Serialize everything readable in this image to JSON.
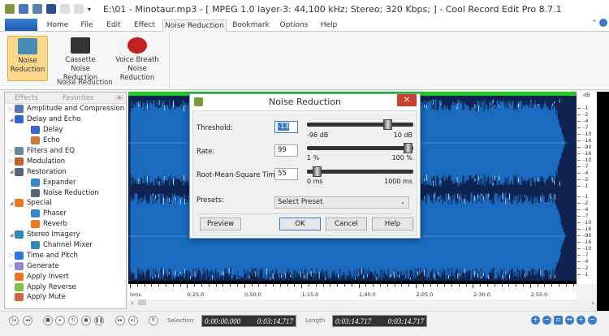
{
  "window": {
    "title": "E:\\01 - Minotaur.mp3 - [ MPEG 1.0 layer-3: 44,100 kHz; Stereo; 320 Kbps;  ] - Cool Record Edit Pro 8.7.1"
  },
  "tabs": [
    {
      "label": "Home"
    },
    {
      "label": "File"
    },
    {
      "label": "Edit"
    },
    {
      "label": "Effect"
    },
    {
      "label": "Noise Reduction"
    },
    {
      "label": "Bookmark"
    },
    {
      "label": "Options"
    },
    {
      "label": "Help"
    }
  ],
  "ribbon": {
    "buttons": [
      {
        "label": "Noise Reduction"
      },
      {
        "label": "Cassette Noise Reduction"
      },
      {
        "label": "Voice Breath Noise Reduction"
      }
    ],
    "group_label": "Noise Reduction"
  },
  "panel": {
    "tabs": [
      "Effects",
      "Favorites"
    ],
    "items": [
      {
        "label": "Amplitude and Compression",
        "level": 0,
        "exp": "closed",
        "color": "#5577aa"
      },
      {
        "label": "Delay and Echo",
        "level": 0,
        "exp": "open",
        "color": "#3366cc"
      },
      {
        "label": "Delay",
        "level": 1,
        "color": "#3366cc"
      },
      {
        "label": "Echo",
        "level": 1,
        "color": "#cc7733"
      },
      {
        "label": "Filters and EQ",
        "level": 0,
        "exp": "closed",
        "color": "#668899"
      },
      {
        "label": "Modulation",
        "level": 0,
        "exp": "closed",
        "color": "#bb6633"
      },
      {
        "label": "Restoration",
        "level": 0,
        "exp": "open",
        "color": "#556677"
      },
      {
        "label": "Expander",
        "level": 1,
        "color": "#3388cc"
      },
      {
        "label": "Noise Reduction",
        "level": 1,
        "color": "#556677"
      },
      {
        "label": "Special",
        "level": 0,
        "exp": "open",
        "color": "#ee7722"
      },
      {
        "label": "Phaser",
        "level": 1,
        "color": "#3388cc"
      },
      {
        "label": "Reverb",
        "level": 1,
        "color": "#ee7722"
      },
      {
        "label": "Stereo Imagery",
        "level": 0,
        "exp": "open",
        "color": "#3388bb"
      },
      {
        "label": "Channel Mixer",
        "level": 1,
        "color": "#3388bb"
      },
      {
        "label": "Time and Pitch",
        "level": 0,
        "exp": "closed",
        "color": "#3377dd"
      },
      {
        "label": "Generate",
        "level": 0,
        "exp": "closed",
        "color": "#9988cc"
      },
      {
        "label": "Apply Invert",
        "level": 0,
        "color": "#ee7722"
      },
      {
        "label": "Apply Reverse",
        "level": 0,
        "color": "#88bb44"
      },
      {
        "label": "Apply Mute",
        "level": 0,
        "color": "#cc6644"
      }
    ]
  },
  "db_scale": {
    "unit": "dB",
    "labels": [
      "-1",
      "-2",
      "-4",
      "-7",
      "-10",
      "-16",
      "-90",
      "-16",
      "-10",
      "-7",
      "-4",
      "-2",
      "-1"
    ]
  },
  "timeline": {
    "labels": [
      "hms",
      "0:25.0",
      "0:50.0",
      "1:15.0",
      "1:40.0",
      "2:05.0",
      "2:30.0",
      "2:55.0"
    ]
  },
  "dialog": {
    "title": "Noise Reduction",
    "close": "✕",
    "threshold": {
      "label": "Threshold:",
      "value": "-13",
      "min": "-96 dB",
      "max": "10 dB",
      "fraction": 0.78
    },
    "rate": {
      "label": "Rate:",
      "value": "99",
      "min": "1 %",
      "max": "100 %",
      "fraction": 0.99
    },
    "rms": {
      "label": "Root-Mean-Square Time:",
      "value": "55",
      "min": "0 ms",
      "max": "1000 ms",
      "fraction": 0.055
    },
    "presets": {
      "label": "Presets:",
      "value": "Select Preset"
    },
    "buttons": {
      "preview": "Preview",
      "ok": "OK",
      "cancel": "Cancel",
      "help": "Help"
    }
  },
  "bottom": {
    "selection_label": "Selection",
    "selection_start": "0:00:00.000",
    "selection_end": "0:03:14.717",
    "length_label": "Length",
    "length_start": "0:03:14.717",
    "length_end": "0:03:14.717",
    "record": "R"
  },
  "colors": {
    "wave": "#1a6bc0",
    "wave_bg": "#0b1a3a",
    "accent": "#3b7cc9"
  }
}
